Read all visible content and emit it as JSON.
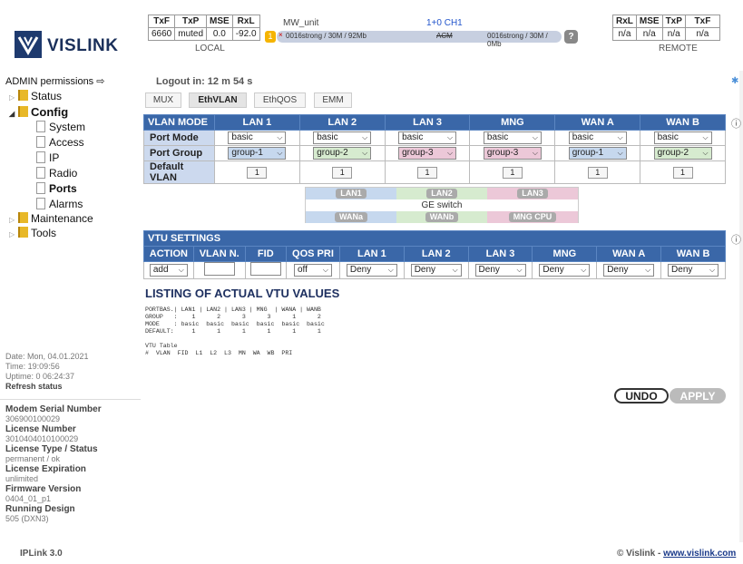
{
  "brand": {
    "name": "VISLINK"
  },
  "local": {
    "headers": [
      "TxF",
      "TxP",
      "MSE",
      "RxL"
    ],
    "values": [
      "6660",
      "muted",
      "0.0",
      "-92.0"
    ],
    "label": "LOCAL"
  },
  "remote": {
    "headers": [
      "RxL",
      "MSE",
      "TxP",
      "TxF"
    ],
    "values": [
      "n/a",
      "n/a",
      "n/a",
      "n/a"
    ],
    "label": "REMOTE"
  },
  "mw": {
    "unit": "MW_unit",
    "channel": "1+0 CH1",
    "left": "0016strong / 30M / 92Mb",
    "mode": "ACM",
    "right": "0016strong / 30M / 0Mb",
    "alarm_count": "1",
    "help": "?"
  },
  "sidebar": {
    "permissions": "ADMIN permissions",
    "items": {
      "status": "Status",
      "config": "Config",
      "system": "System",
      "access": "Access",
      "ip": "IP",
      "radio": "Radio",
      "ports": "Ports",
      "alarms": "Alarms",
      "maintenance": "Maintenance",
      "tools": "Tools"
    }
  },
  "status_box": {
    "date": "Date: Mon, 04.01.2021",
    "time": "Time: 19:09:56",
    "uptime": "Uptime: 0 06:24:37",
    "refresh": "Refresh status"
  },
  "device_info": {
    "serial_label": "Modem Serial Number",
    "serial": "306900100029",
    "license_label": "License Number",
    "license": "3010404010100029",
    "ltype_label": "License Type / Status",
    "ltype": "permanent / ok",
    "lexp_label": "License Expiration",
    "lexp": "unlimited",
    "fw_label": "Firmware Version",
    "fw": "0404_01_p1",
    "design_label": "Running Design",
    "design": "505 (DXN3)"
  },
  "logout": "Logout in: 12 m 54 s",
  "tabs": [
    "MUX",
    "EthVLAN",
    "EthQOS",
    "EMM"
  ],
  "vlan_table": {
    "headers": [
      "VLAN MODE",
      "LAN 1",
      "LAN 2",
      "LAN 3",
      "MNG",
      "WAN A",
      "WAN B"
    ],
    "port_mode_label": "Port Mode",
    "port_mode": [
      "basic",
      "basic",
      "basic",
      "basic",
      "basic",
      "basic"
    ],
    "port_group_label": "Port Group",
    "port_group": [
      "group-1",
      "group-2",
      "group-3",
      "group-3",
      "group-1",
      "group-2"
    ],
    "default_vlan_label": "Default VLAN",
    "default_vlan": [
      "1",
      "1",
      "1",
      "1",
      "1",
      "1"
    ]
  },
  "switch": {
    "lan1": "LAN1",
    "lan2": "LAN2",
    "lan3": "LAN3",
    "title": "GE switch",
    "wana": "WANa",
    "wanb": "WANb",
    "mng": "MNG CPU"
  },
  "vtu": {
    "title": "VTU SETTINGS",
    "headers": [
      "ACTION",
      "VLAN N.",
      "FID",
      "QOS PRI",
      "LAN 1",
      "LAN 2",
      "LAN 3",
      "MNG",
      "WAN A",
      "WAN B"
    ],
    "action": "add",
    "qos": "off",
    "ports": [
      "Deny",
      "Deny",
      "Deny",
      "Deny",
      "Deny",
      "Deny"
    ]
  },
  "listing": {
    "title": "LISTING OF ACTUAL VTU VALUES",
    "lines": [
      "PORTBAS.| LAN1 | LAN2 | LAN3 | MNG  | WANA | WANB",
      "GROUP   :    1      2      3      3      1      2",
      "MODE    : basic  basic  basic  basic  basic  basic",
      "DEFAULT:     1      1      1      1      1      1",
      "",
      "VTU Table",
      "#  VLAN  FID  L1  L2  L3  MN  WA  WB  PRI"
    ]
  },
  "buttons": {
    "undo": "UNDO",
    "apply": "APPLY"
  },
  "footer": {
    "version": "IPLink 3.0",
    "copyright": "© Vislink - ",
    "link": "www.vislink.com"
  },
  "colors": {
    "header_blue": "#3a67a8",
    "label_blue": "#ccd9ee",
    "lan1": "#c6d8ee",
    "lan2": "#d6ebcf",
    "lan3": "#ecc8d8"
  }
}
